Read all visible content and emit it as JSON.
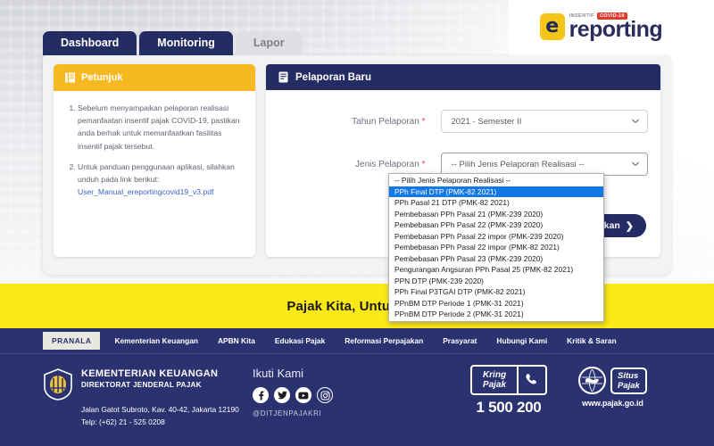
{
  "brand": {
    "logo_icon": "e-logo-icon",
    "tag_small": "INSENTIF",
    "tag_badge": "COVID-19",
    "logo_text": "reporting"
  },
  "tabs": [
    {
      "label": "Dashboard",
      "state": "active"
    },
    {
      "label": "Monitoring",
      "state": "active"
    },
    {
      "label": "Lapor",
      "state": "inactive"
    }
  ],
  "petunjuk": {
    "icon": "info-list-icon",
    "title": "Petunjuk",
    "items": [
      "Sebelum menyampaikan pelaporan realisasi pemanfaatan insentif pajak COVID-19, pastikan anda berhak untuk memanfaatkan fasilitas insentif pajak tersebut.",
      "Untuk panduan penggunaan aplikasi, silahkan unduh pada link berikut:"
    ],
    "link_text": "User_Manual_ereportingcovid19_v3.pdf"
  },
  "form": {
    "icon": "document-icon",
    "title": "Pelaporan Baru",
    "fields": [
      {
        "label": "Tahun Pelaporan",
        "required_mark": "*",
        "value": "2021 - Semester II",
        "caret_icon": "chevron-down-icon"
      },
      {
        "label": "Jenis Pelaporan",
        "required_mark": "*",
        "value": "-- Pilih Jenis Pelaporan Realisasi --",
        "caret_icon": "chevron-down-icon"
      }
    ],
    "submit_label": "Lanjutkan",
    "submit_arrow": "❯"
  },
  "dropdown": {
    "open": true,
    "selected_index": 1,
    "options": [
      "-- Pilih Jenis Pelaporan Realisasi --",
      "PPh Final DTP (PMK-82 2021)",
      "PPh Pasal 21 DTP (PMK-82 2021)",
      "Pembebasan PPh Pasal 21 (PMK-239 2020)",
      "Pembebasan PPh Pasal 22 (PMK-239 2020)",
      "Pembebasan PPh Pasal 22 impor (PMK-239 2020)",
      "Pembebasan PPh Pasal 22 impor (PMK-82 2021)",
      "Pembebasan PPh Pasal 23 (PMK-239 2020)",
      "Pengurangan Angsuran PPh Pasal 25 (PMK-82 2021)",
      "PPN DTP (PMK-239 2020)",
      "PPh Final P3TGAI DTP (PMK-82 2021)",
      "PPnBM DTP Periode 1 (PMK-31 2021)",
      "PPnBM DTP Periode 2 (PMK-31 2021)"
    ]
  },
  "banner": {
    "text": "Pajak Kita, Untuk Kita"
  },
  "footer": {
    "pranala_label": "PRANALA",
    "links": [
      "Kementerian Keuangan",
      "APBN Kita",
      "Edukasi Pajak",
      "Reformasi Perpajakan",
      "Prasyarat",
      "Hubungi Kami",
      "Kritik & Saran"
    ],
    "ministry": {
      "seal_icon": "kemenkeu-seal-icon",
      "line1": "KEMENTERIAN KEUANGAN",
      "line2": "DIREKTORAT JENDERAL PAJAK",
      "address": "Jalan Gatot Subroto, Kav. 40-42, Jakarta 12190",
      "phone": "Telp: (+62) 21 - 525 0208"
    },
    "social": {
      "title": "Ikuti Kami",
      "icons": [
        "facebook-icon",
        "twitter-icon",
        "youtube-icon",
        "instagram-icon"
      ],
      "handle": "@DITJENPAJAKRI"
    },
    "kring": {
      "badge_line1": "Kring",
      "badge_line2": "Pajak",
      "phone_icon": "telephone-icon",
      "number": "1 500 200"
    },
    "situs": {
      "globe_icon": "globe-indonesia-icon",
      "badge_line1": "Situs",
      "badge_line2": "Pajak",
      "url": "www.pajak.go.id"
    }
  },
  "colors": {
    "navy": "#232c63",
    "footer_navy": "#2b3270",
    "yellow_banner": "#fbe817",
    "amber": "#f6b922",
    "select_highlight": "#1278e8",
    "link_blue": "#3a63c8"
  }
}
